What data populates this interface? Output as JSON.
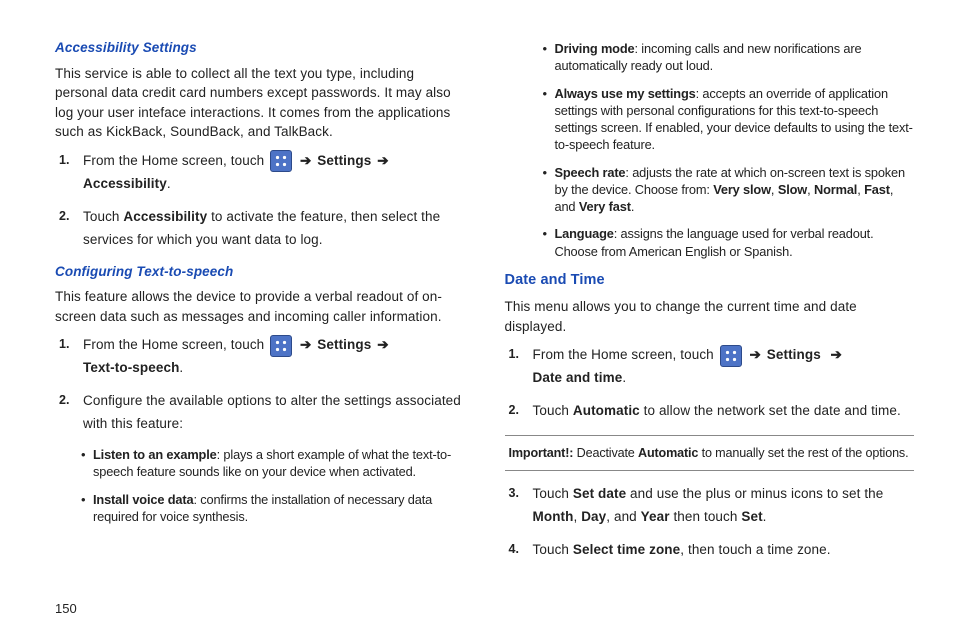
{
  "page_number": "150",
  "left": {
    "accessibility": {
      "heading": "Accessibility Settings",
      "intro": "This service is able to collect all the text you type, including personal data credit card numbers except passwords. It may also log your user inteface interactions. It comes from the applications such as KickBack, SoundBack, and TalkBack.",
      "step1_a": "From the Home screen, touch ",
      "step1_b": "Settings",
      "step1_c": "Accessibility",
      "step2_a": "Touch ",
      "step2_b": "Accessibility",
      "step2_c": " to activate the feature, then select the services for which you want data to log."
    },
    "tts": {
      "heading": "Configuring Text-to-speech",
      "intro": "This feature allows the device to provide a verbal readout of on-screen data such as messages and incoming caller information.",
      "step1_a": "From the Home screen, touch ",
      "step1_b": "Settings",
      "step1_c": "Text-to-speech",
      "step2": "Configure the available options to alter the settings associated with this feature:",
      "bullet1_label": "Listen to an example",
      "bullet1_text": ": plays a short example of what the text-to-speech feature sounds like on your device when activated.",
      "bullet2_label": "Install voice data",
      "bullet2_text": ": confirms the installation of necessary data required for voice synthesis."
    }
  },
  "right": {
    "bullets": {
      "driving_label": "Driving mode",
      "driving_text": ": incoming calls and new norifications are automatically ready out loud.",
      "always_label": "Always use my settings",
      "always_text": ": accepts an override of application settings with personal configurations for this text-to-speech settings screen. If enabled, your device defaults to using the text-to-speech feature.",
      "speech_label": "Speech rate",
      "speech_a": ": adjusts the rate at which on-screen text is spoken by the device. Choose from: ",
      "speech_vslow": "Very slow",
      "speech_slow": "Slow",
      "speech_normal": "Normal",
      "speech_fast": "Fast",
      "speech_and": ", and ",
      "speech_vfast": "Very fast",
      "lang_label": "Language",
      "lang_text": ": assigns the language used for verbal readout. Choose from American English or Spanish."
    },
    "datetime": {
      "heading": "Date and Time",
      "intro": "This menu allows you to change the current time and date displayed.",
      "step1_a": "From the Home screen, touch ",
      "step1_b": "Settings",
      "step1_c": "Date and time",
      "step2_a": "Touch ",
      "step2_b": "Automatic",
      "step2_c": " to allow the network set the date and time.",
      "important_label": "Important!:",
      "important_a": " Deactivate ",
      "important_b": "Automatic",
      "important_c": " to manually set the rest of the options.",
      "step3_a": "Touch ",
      "step3_b": "Set date",
      "step3_c": " and use the plus or minus icons to set the ",
      "step3_month": "Month",
      "step3_day": "Day",
      "step3_year": "Year",
      "step3_d": " then touch ",
      "step3_set": "Set",
      "step4_a": "Touch ",
      "step4_b": "Select time zone",
      "step4_c": ", then touch a time zone."
    }
  },
  "glyphs": {
    "arrow": "➔",
    "comma_sp": ", ",
    "period": "."
  },
  "nums": {
    "n1": "1.",
    "n2": "2.",
    "n3": "3.",
    "n4": "4."
  }
}
